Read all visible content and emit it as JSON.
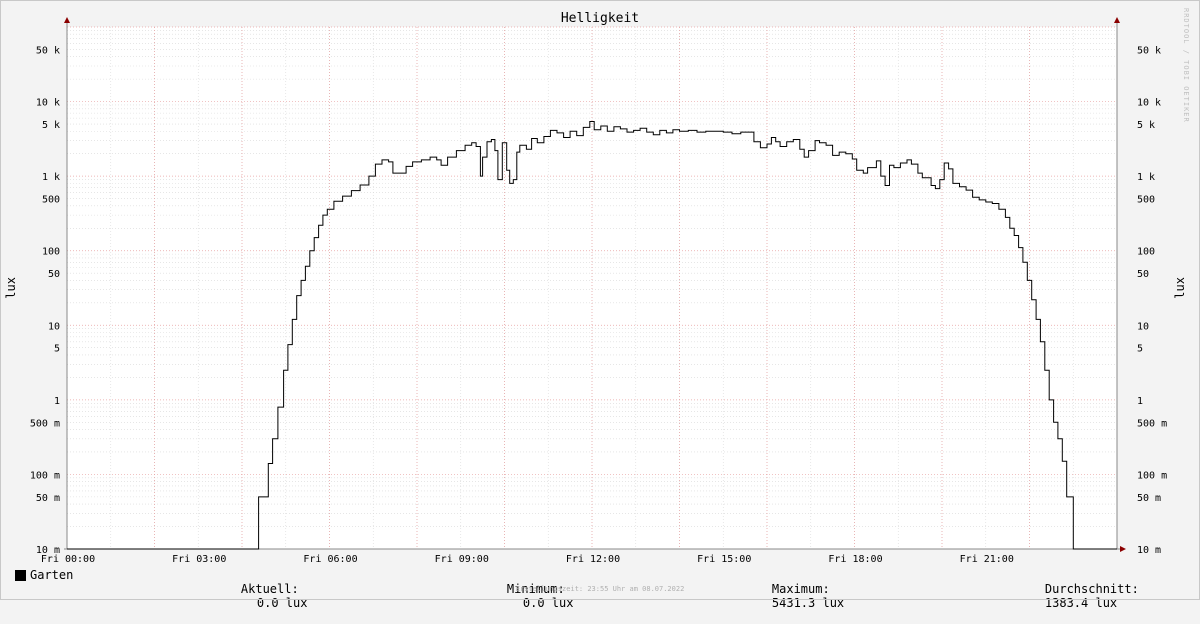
{
  "chart_data": {
    "type": "line",
    "title": "Helligkeit",
    "ylabel": "lux",
    "ylabel_right": "lux",
    "yscale": "log",
    "ylim": [
      0.01,
      100000
    ],
    "y_ticks": [
      {
        "value": 50000,
        "label": "50 k"
      },
      {
        "value": 10000,
        "label": "10 k"
      },
      {
        "value": 5000,
        "label": "5 k"
      },
      {
        "value": 1000,
        "label": "1 k"
      },
      {
        "value": 500,
        "label": "500"
      },
      {
        "value": 100,
        "label": "100"
      },
      {
        "value": 50,
        "label": "50"
      },
      {
        "value": 10,
        "label": "10"
      },
      {
        "value": 5,
        "label": "5"
      },
      {
        "value": 1,
        "label": "1"
      },
      {
        "value": 0.5,
        "label": "500 m"
      },
      {
        "value": 0.1,
        "label": "100 m"
      },
      {
        "value": 0.05,
        "label": "50 m"
      },
      {
        "value": 0.01,
        "label": "10 m"
      }
    ],
    "x_range_hours": [
      0,
      24
    ],
    "x_ticks": [
      {
        "hour": 0,
        "label": "Fri 00:00"
      },
      {
        "hour": 3,
        "label": "Fri 03:00"
      },
      {
        "hour": 6,
        "label": "Fri 06:00"
      },
      {
        "hour": 9,
        "label": "Fri 09:00"
      },
      {
        "hour": 12,
        "label": "Fri 12:00"
      },
      {
        "hour": 15,
        "label": "Fri 15:00"
      },
      {
        "hour": 18,
        "label": "Fri 18:00"
      },
      {
        "hour": 21,
        "label": "Fri 21:00"
      }
    ],
    "series": [
      {
        "name": "Garten",
        "color": "#000000",
        "points": [
          [
            0.0,
            0.01
          ],
          [
            4.35,
            0.01
          ],
          [
            4.38,
            0.05
          ],
          [
            4.55,
            0.05
          ],
          [
            4.6,
            0.14
          ],
          [
            4.7,
            0.3
          ],
          [
            4.82,
            0.8
          ],
          [
            4.95,
            2.5
          ],
          [
            5.05,
            5.5
          ],
          [
            5.15,
            12
          ],
          [
            5.25,
            25
          ],
          [
            5.35,
            40
          ],
          [
            5.45,
            62
          ],
          [
            5.55,
            100
          ],
          [
            5.65,
            150
          ],
          [
            5.75,
            220
          ],
          [
            5.85,
            300
          ],
          [
            5.95,
            360
          ],
          [
            6.1,
            460
          ],
          [
            6.3,
            540
          ],
          [
            6.5,
            640
          ],
          [
            6.7,
            760
          ],
          [
            6.9,
            1000
          ],
          [
            7.05,
            1450
          ],
          [
            7.2,
            1650
          ],
          [
            7.35,
            1550
          ],
          [
            7.45,
            1100
          ],
          [
            7.6,
            1100
          ],
          [
            7.75,
            1350
          ],
          [
            7.9,
            1550
          ],
          [
            8.1,
            1650
          ],
          [
            8.3,
            1800
          ],
          [
            8.45,
            1650
          ],
          [
            8.55,
            1400
          ],
          [
            8.7,
            1800
          ],
          [
            8.9,
            2200
          ],
          [
            9.1,
            2600
          ],
          [
            9.25,
            2800
          ],
          [
            9.35,
            2500
          ],
          [
            9.45,
            1000
          ],
          [
            9.5,
            1800
          ],
          [
            9.6,
            2900
          ],
          [
            9.7,
            3100
          ],
          [
            9.78,
            2200
          ],
          [
            9.85,
            900
          ],
          [
            9.95,
            2800
          ],
          [
            10.05,
            1200
          ],
          [
            10.12,
            800
          ],
          [
            10.2,
            900
          ],
          [
            10.28,
            2100
          ],
          [
            10.35,
            2600
          ],
          [
            10.5,
            2300
          ],
          [
            10.62,
            3200
          ],
          [
            10.75,
            2800
          ],
          [
            10.9,
            3400
          ],
          [
            11.05,
            4100
          ],
          [
            11.2,
            3800
          ],
          [
            11.35,
            3300
          ],
          [
            11.5,
            4000
          ],
          [
            11.65,
            3500
          ],
          [
            11.8,
            4500
          ],
          [
            11.95,
            5400
          ],
          [
            12.05,
            4200
          ],
          [
            12.2,
            4700
          ],
          [
            12.35,
            4000
          ],
          [
            12.5,
            4600
          ],
          [
            12.65,
            4300
          ],
          [
            12.8,
            3900
          ],
          [
            12.95,
            4100
          ],
          [
            13.1,
            4400
          ],
          [
            13.25,
            3900
          ],
          [
            13.4,
            3600
          ],
          [
            13.55,
            4100
          ],
          [
            13.7,
            3800
          ],
          [
            13.85,
            4200
          ],
          [
            14.0,
            4000
          ],
          [
            14.2,
            4100
          ],
          [
            14.4,
            3900
          ],
          [
            14.6,
            4000
          ],
          [
            14.8,
            4000
          ],
          [
            15.0,
            3900
          ],
          [
            15.2,
            3700
          ],
          [
            15.4,
            3900
          ],
          [
            15.6,
            3900
          ],
          [
            15.7,
            2900
          ],
          [
            15.85,
            2400
          ],
          [
            16.0,
            2700
          ],
          [
            16.1,
            3300
          ],
          [
            16.2,
            2900
          ],
          [
            16.3,
            2500
          ],
          [
            16.45,
            2900
          ],
          [
            16.6,
            3100
          ],
          [
            16.75,
            2300
          ],
          [
            16.85,
            1800
          ],
          [
            16.95,
            2200
          ],
          [
            17.1,
            3000
          ],
          [
            17.2,
            2800
          ],
          [
            17.35,
            2600
          ],
          [
            17.5,
            1900
          ],
          [
            17.65,
            2100
          ],
          [
            17.8,
            2000
          ],
          [
            17.95,
            1700
          ],
          [
            18.05,
            1200
          ],
          [
            18.2,
            1100
          ],
          [
            18.3,
            1300
          ],
          [
            18.5,
            1600
          ],
          [
            18.6,
            1000
          ],
          [
            18.7,
            750
          ],
          [
            18.8,
            1400
          ],
          [
            18.9,
            1300
          ],
          [
            19.05,
            1500
          ],
          [
            19.2,
            1650
          ],
          [
            19.3,
            1450
          ],
          [
            19.45,
            1100
          ],
          [
            19.55,
            950
          ],
          [
            19.75,
            750
          ],
          [
            19.85,
            680
          ],
          [
            19.95,
            900
          ],
          [
            20.05,
            1500
          ],
          [
            20.15,
            1250
          ],
          [
            20.25,
            800
          ],
          [
            20.4,
            720
          ],
          [
            20.55,
            650
          ],
          [
            20.7,
            520
          ],
          [
            20.85,
            480
          ],
          [
            21.0,
            450
          ],
          [
            21.15,
            430
          ],
          [
            21.3,
            360
          ],
          [
            21.45,
            280
          ],
          [
            21.55,
            200
          ],
          [
            21.65,
            160
          ],
          [
            21.75,
            110
          ],
          [
            21.85,
            70
          ],
          [
            21.95,
            40
          ],
          [
            22.05,
            22
          ],
          [
            22.15,
            12
          ],
          [
            22.25,
            6
          ],
          [
            22.35,
            2.5
          ],
          [
            22.45,
            1
          ],
          [
            22.55,
            0.5
          ],
          [
            22.65,
            0.3
          ],
          [
            22.75,
            0.15
          ],
          [
            22.85,
            0.05
          ],
          [
            22.95,
            0.05
          ],
          [
            23.0,
            0.01
          ],
          [
            24.0,
            0.01
          ]
        ]
      }
    ],
    "legend": {
      "name": "Garten",
      "current_label": "Aktuell:",
      "current_value": "0.0 lux",
      "min_label": "Minimum:",
      "min_value": "0.0 lux",
      "max_label": "Maximum:",
      "max_value": "5431.3 lux",
      "avg_label": "Durchschnitt:",
      "avg_value": "1383.4 lux"
    },
    "grid": true,
    "legend_position": "bottom"
  },
  "watermark": "RRDTOOL / TOBI OETIKER",
  "footer": "Erstellungszeit: 23:55 Uhr am 08.07.2022",
  "colors": {
    "background": "#f3f3f3",
    "plot_background": "#ffffff",
    "minor_grid": "#d8d8d8",
    "major_grid": "#e8a0a0",
    "axis": "#888888",
    "arrow": "#8b0000",
    "line": "#000000"
  }
}
